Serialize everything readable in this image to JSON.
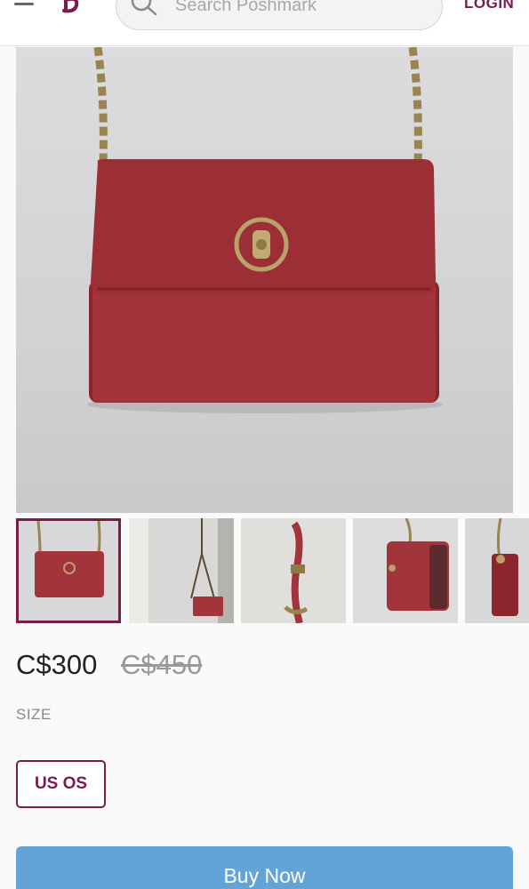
{
  "header": {
    "search_placeholder": "Search Poshmark",
    "login_label": "LOGIN"
  },
  "listing": {
    "price": "C$300",
    "original_price": "C$450",
    "size_label": "SIZE",
    "size_option": "US OS"
  },
  "actions": {
    "buy_now_label": "Buy Now"
  },
  "colors": {
    "brand": "#7a1b4a",
    "buy_button": "#62a3d8",
    "bag": "#a3343b"
  }
}
